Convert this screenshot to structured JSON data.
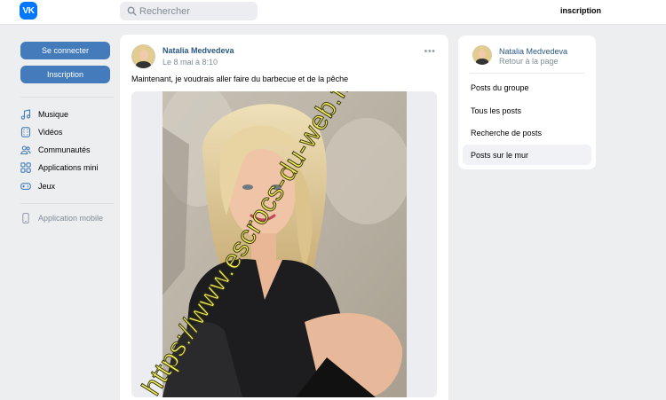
{
  "header": {
    "logo_text": "VK",
    "search_placeholder": "Rechercher",
    "signup_link": "inscription"
  },
  "sidebar": {
    "login_button": "Se connecter",
    "signup_button": "Inscription",
    "items": [
      {
        "label": "Musique",
        "icon": "music-icon"
      },
      {
        "label": "Vidéos",
        "icon": "video-icon"
      },
      {
        "label": "Communautés",
        "icon": "communities-icon"
      },
      {
        "label": "Applications mini",
        "icon": "mini-apps-icon"
      },
      {
        "label": "Jeux",
        "icon": "gamepad-icon"
      }
    ],
    "mobile_app": {
      "label": "Application mobile",
      "icon": "phone-icon"
    }
  },
  "post": {
    "author": "Natalia Medvedeva",
    "date": "Le 8 mai à 8:10",
    "text": "Maintenant, je voudrais aller faire du barbecue et de la pêche",
    "watermark": "https://www.escrocs-du-web.fr"
  },
  "right_panel": {
    "name": "Natalia Medvedeva",
    "back_label": "Retour à la page",
    "links": [
      {
        "label": "Posts du groupe",
        "active": false
      },
      {
        "label": "Tous les posts",
        "active": false
      },
      {
        "label": "Recherche de posts",
        "active": false
      },
      {
        "label": "Posts sur le mur",
        "active": true
      }
    ]
  },
  "colors": {
    "accent": "#0077ff",
    "button": "#447bba",
    "link": "#2a5885",
    "background": "#edeef0"
  }
}
